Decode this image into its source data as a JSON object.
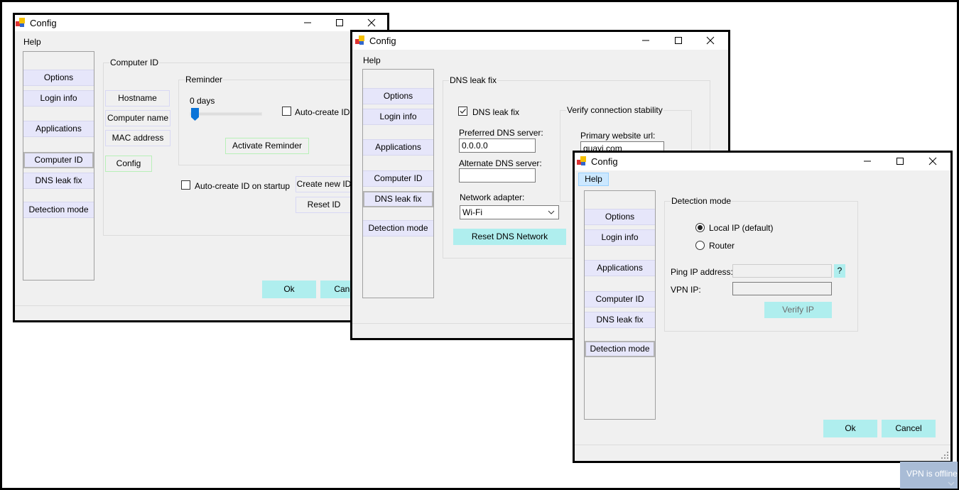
{
  "colors": {
    "accent_button": "#afeeee",
    "sidebar_item": "#e6e6fa",
    "help_highlight": "#cce8ff",
    "toast": "#a9bcd6"
  },
  "sidebar_items": [
    "Options",
    "Login info",
    "Applications",
    "Computer ID",
    "DNS leak fix",
    "Detection mode"
  ],
  "window1": {
    "title": "Config",
    "menu_help": "Help",
    "selected": "Computer ID",
    "group_title": "Computer  ID",
    "buttons": {
      "hostname": "Hostname",
      "computer_name": "Computer name",
      "mac_address": "MAC address",
      "config": "Config",
      "create_new_id": "Create new ID",
      "reset_id": "Reset ID",
      "ok": "Ok",
      "cancel": "Cancel"
    },
    "reminder": {
      "title": "Reminder",
      "days_label": "0 days",
      "slider_value": 0,
      "auto_create_label": "Auto-create ID",
      "auto_create_checked": false,
      "activate_label": "Activate Reminder"
    },
    "auto_startup_label": "Auto-create ID on startup",
    "auto_startup_checked": false
  },
  "window2": {
    "title": "Config",
    "menu_help": "Help",
    "selected": "DNS leak fix",
    "group_title": "DNS leak fix",
    "dns_leak_fix_label": "DNS leak fix",
    "dns_leak_fix_checked": true,
    "preferred_label": "Preferred DNS server:",
    "preferred_value": "0.0.0.0",
    "alternate_label": "Alternate DNS server:",
    "alternate_value": "",
    "adapter_label": "Network adapter:",
    "adapter_value": "Wi-Fi",
    "reset_label": "Reset DNS Network",
    "verify_group_title": "Verify connection stability",
    "primary_url_label": "Primary website url:",
    "primary_url_value": "guayi.com"
  },
  "window3": {
    "title": "Config",
    "menu_help": "Help",
    "selected": "Detection mode",
    "group_title": "Detection mode",
    "radio_local": "Local IP (default)",
    "radio_router": "Router",
    "selected_mode": "local",
    "ping_label": "Ping IP address:",
    "ping_value": "",
    "help_button": "?",
    "vpn_ip_label": "VPN IP:",
    "vpn_ip_value": "",
    "verify_label": "Verify IP",
    "ok": "Ok",
    "cancel": "Cancel"
  },
  "toast": {
    "text": "VPN is offline"
  }
}
